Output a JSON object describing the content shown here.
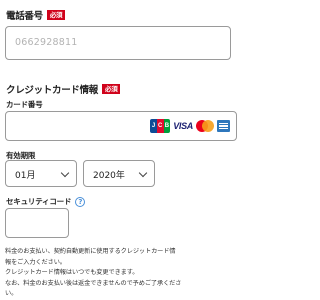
{
  "phone": {
    "title": "電話番号",
    "required": "必須",
    "value": "0662928811"
  },
  "credit_card": {
    "title": "クレジットカード情報",
    "required": "必須",
    "number_label": "カード番号",
    "brands": {
      "jcb": [
        "J",
        "C",
        "B"
      ],
      "visa": "VISA",
      "icons": [
        "jcb-logo-icon",
        "visa-logo-icon",
        "mastercard-logo-icon",
        "amex-logo-icon"
      ]
    },
    "expiry_label": "有効期限",
    "month_value": "01月",
    "year_value": "2020年",
    "cvc_label": "セキュリティコード",
    "help": "?"
  },
  "notice": {
    "lines": [
      "料金のお支払い、契約自動更新に使用するクレジットカード情",
      "報をご入力ください。",
      "クレジットカード情報はいつでも変更できます。",
      "なお、料金のお支払い後は返金できませんので予めご了承くださ",
      "い。"
    ]
  },
  "colors": {
    "required_badge": "#d0021b",
    "help_icon": "#4a90d9",
    "border": "#9a9a9a",
    "placeholder_text": "#b3b3b3"
  }
}
